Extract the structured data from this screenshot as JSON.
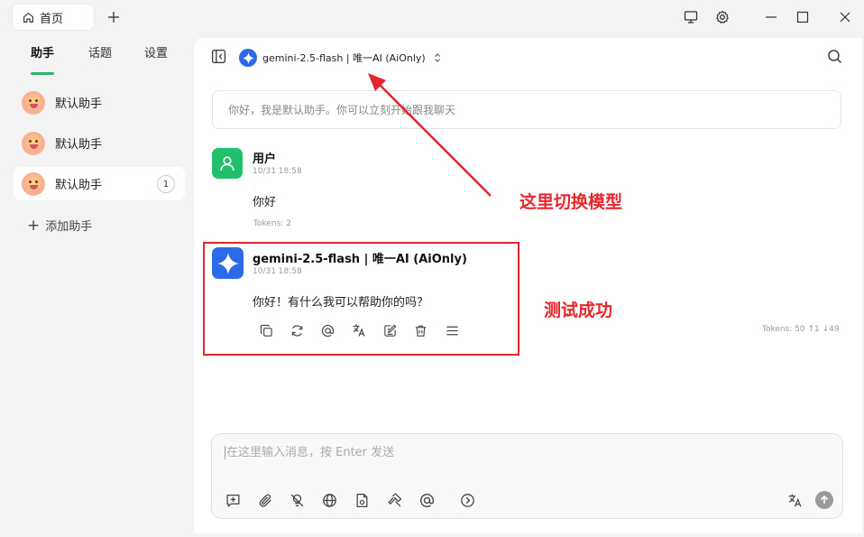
{
  "titlebar": {
    "tab_label": "首页",
    "home_icon": "home-icon",
    "add_tab_icon": "plus-icon",
    "window_buttons": [
      "monitor-icon",
      "gear-icon",
      "minimize-icon",
      "maximize-icon",
      "close-icon"
    ]
  },
  "sidebar": {
    "tabs": [
      {
        "label": "助手",
        "active": true
      },
      {
        "label": "话题",
        "active": false
      },
      {
        "label": "设置",
        "active": false
      }
    ],
    "assistants": [
      {
        "label": "默认助手",
        "badge": ""
      },
      {
        "label": "默认助手",
        "badge": ""
      },
      {
        "label": "默认助手",
        "badge": "1"
      }
    ],
    "add_label": "添加助手",
    "accent_color": "#2db36a"
  },
  "main": {
    "model_label": "gemini-2.5-flash | 唯一AI (AiOnly)",
    "welcome": "你好，我是默认助手。你可以立刻开始跟我聊天",
    "messages": [
      {
        "role": "user",
        "name": "用户",
        "time": "10/31 18:58",
        "text": "你好",
        "tokens": "Tokens: 2"
      },
      {
        "role": "assistant",
        "name": "gemini-2.5-flash | 唯一AI (AiOnly)",
        "time": "10/31 18:58",
        "text": "你好！有什么我可以帮助你的吗？",
        "tokens": "Tokens: 50 ↑1 ↓49"
      }
    ],
    "message_actions": [
      "copy-icon",
      "regenerate-icon",
      "mention-icon",
      "translate-icon",
      "edit-icon",
      "delete-icon",
      "menu-icon"
    ],
    "input": {
      "placeholder": "在这里输入消息，按 Enter 发送",
      "value": ""
    },
    "input_tools": [
      "new-topic-icon",
      "attachment-icon",
      "web-search-off-icon",
      "globe-icon",
      "file-icon",
      "hammer-icon",
      "mention-icon",
      "expand-icon"
    ]
  },
  "annotations": {
    "model_switch": "这里切换模型",
    "test_success": "测试成功",
    "color": "#e8262c"
  }
}
